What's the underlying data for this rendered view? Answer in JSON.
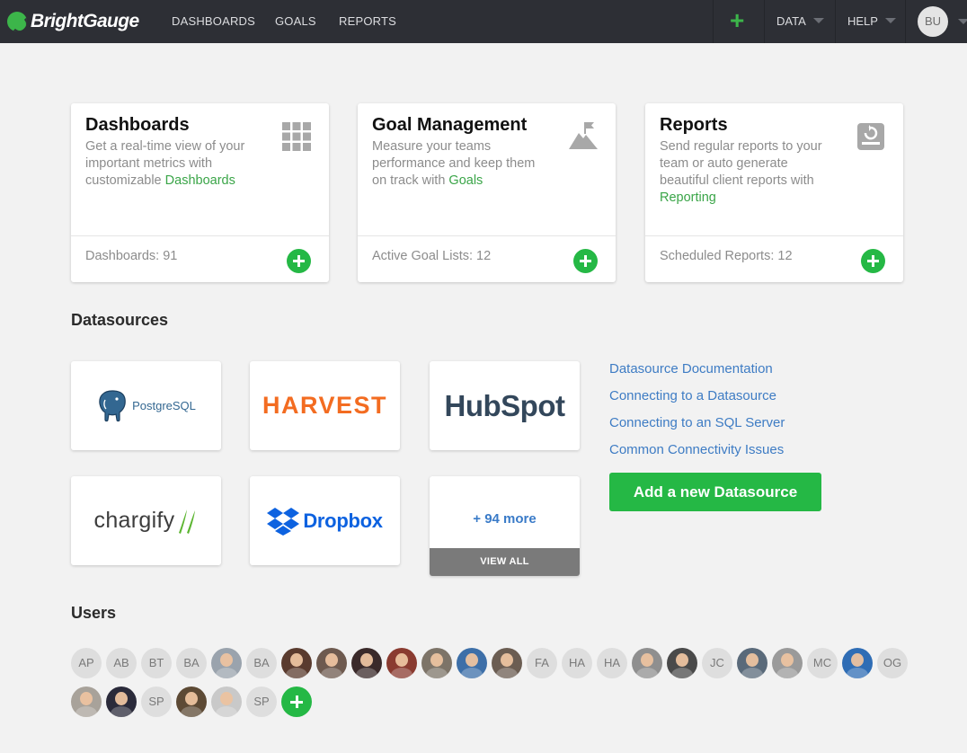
{
  "nav": {
    "brand": "BrightGauge",
    "links": [
      "DASHBOARDS",
      "GOALS",
      "REPORTS"
    ],
    "plus_icon": "plus-icon",
    "data_label": "DATA",
    "help_label": "HELP",
    "avatar_initials": "BU"
  },
  "cards": [
    {
      "title": "Dashboards",
      "desc": "Get a real-time view of your important metrics with customizable ",
      "link": "Dashboards",
      "count": "Dashboards: 91",
      "icon": "grid-icon"
    },
    {
      "title": "Goal Management",
      "desc": "Measure your teams performance and keep them on track with ",
      "link": "Goals",
      "count": "Active Goal Lists: 12",
      "icon": "mountain-flag-icon"
    },
    {
      "title": "Reports",
      "desc": "Send regular reports to your team or auto generate beautiful client reports with ",
      "link": "Reporting",
      "count": "Scheduled Reports: 12",
      "icon": "report-icon"
    }
  ],
  "datasources": {
    "title": "Datasources",
    "tiles": [
      "PostgreSQL",
      "HARVEST",
      "HubSpot",
      "chargify",
      "Dropbox"
    ],
    "more": "+ 94 more",
    "view_all": "VIEW ALL",
    "links": [
      "Datasource Documentation",
      "Connecting to a Datasource",
      "Connecting to an SQL Server",
      "Common Connectivity Issues"
    ],
    "add_button": "Add a new Datasource"
  },
  "users": {
    "title": "Users",
    "avatars": [
      {
        "type": "initials",
        "text": "AP"
      },
      {
        "type": "initials",
        "text": "AB"
      },
      {
        "type": "initials",
        "text": "BT"
      },
      {
        "type": "initials",
        "text": "BA"
      },
      {
        "type": "photo",
        "bg": "#9aa3ad"
      },
      {
        "type": "initials",
        "text": "BA"
      },
      {
        "type": "photo",
        "bg": "#5a3b2e"
      },
      {
        "type": "photo",
        "bg": "#6e5a4f"
      },
      {
        "type": "photo",
        "bg": "#3a2a2a"
      },
      {
        "type": "photo",
        "bg": "#8a3b30"
      },
      {
        "type": "photo",
        "bg": "#7d7468"
      },
      {
        "type": "photo",
        "bg": "#3d6fa8"
      },
      {
        "type": "photo",
        "bg": "#6b5d52"
      },
      {
        "type": "initials",
        "text": "FA"
      },
      {
        "type": "initials",
        "text": "HA"
      },
      {
        "type": "initials",
        "text": "HA"
      },
      {
        "type": "photo",
        "bg": "#8f8f8f"
      },
      {
        "type": "photo",
        "bg": "#4a4a4a"
      },
      {
        "type": "initials",
        "text": "JC"
      },
      {
        "type": "photo",
        "bg": "#5a6a7a"
      },
      {
        "type": "photo",
        "bg": "#9a9a9a"
      },
      {
        "type": "initials",
        "text": "MC"
      },
      {
        "type": "photo",
        "bg": "#2f6db5"
      },
      {
        "type": "initials",
        "text": "OG"
      },
      {
        "type": "photo",
        "bg": "#a8a29a"
      },
      {
        "type": "photo",
        "bg": "#2a2a3a"
      },
      {
        "type": "initials",
        "text": "SP"
      },
      {
        "type": "photo",
        "bg": "#5d4a35"
      },
      {
        "type": "photo",
        "bg": "#c9c9c9"
      },
      {
        "type": "initials",
        "text": "SP"
      },
      {
        "type": "add"
      }
    ]
  },
  "colors": {
    "accent_green": "#25b845",
    "link_blue": "#3e7cc4",
    "nav_bg": "#2d2f35"
  }
}
